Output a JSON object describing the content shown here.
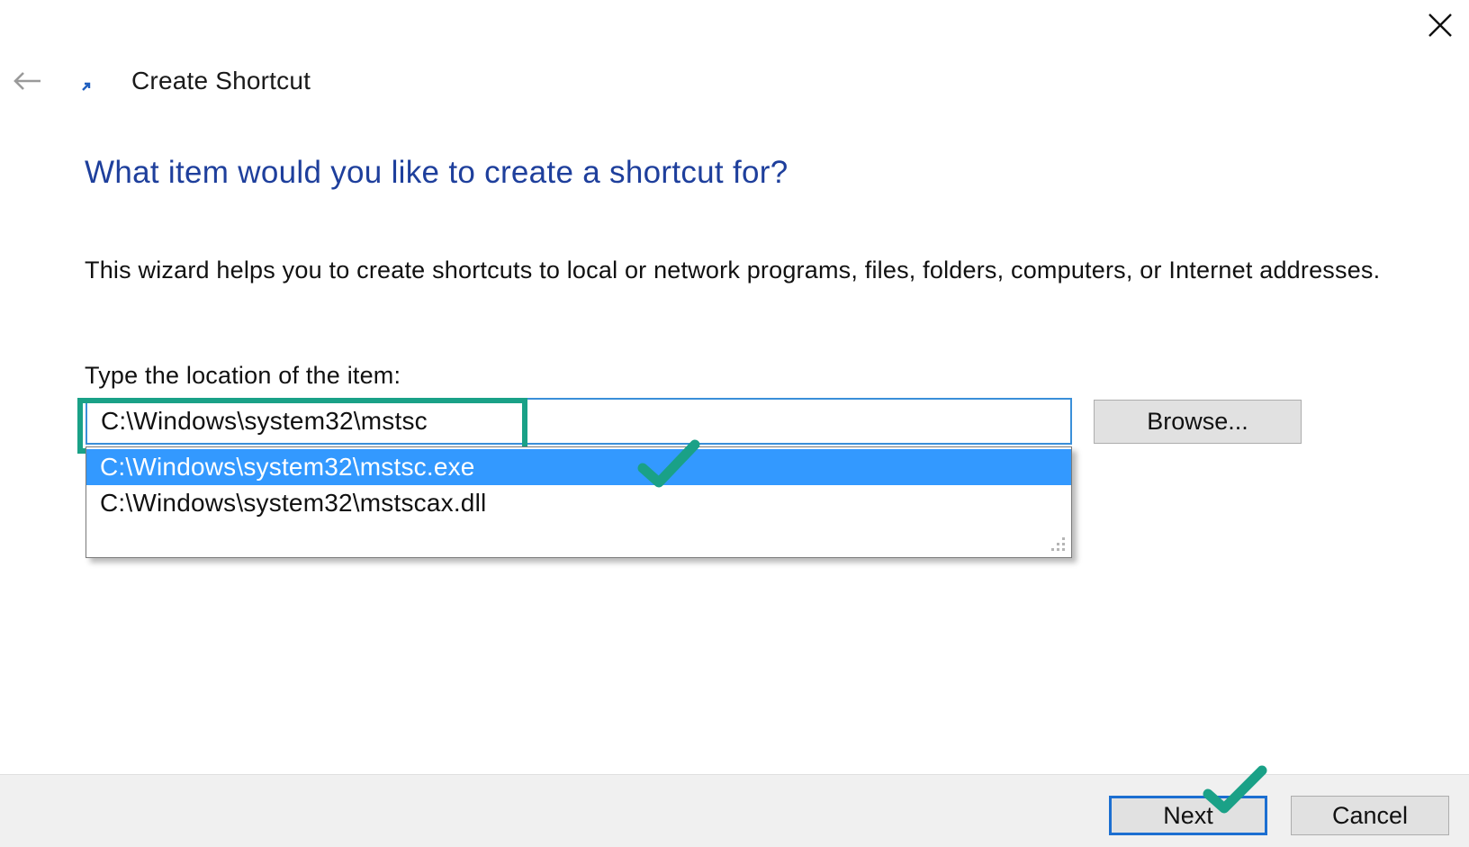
{
  "window": {
    "title": "Create Shortcut",
    "close_icon": "close-icon",
    "back_icon": "back-arrow-icon",
    "app_icon": "shortcut-arrow-icon"
  },
  "main": {
    "heading": "What item would you like to create a shortcut for?",
    "description": "This wizard helps you to create shortcuts to local or network programs, files, folders, computers, or Internet addresses.",
    "field_label": "Type the location of the item:",
    "location_value": "C:\\Windows\\system32\\mstsc",
    "browse_label": "Browse..."
  },
  "autocomplete": {
    "items": [
      {
        "label": "C:\\Windows\\system32\\mstsc.exe",
        "selected": true
      },
      {
        "label": "C:\\Windows\\system32\\mstscax.dll",
        "selected": false
      }
    ]
  },
  "footer": {
    "next_label": "Next",
    "cancel_label": "Cancel"
  },
  "annotations": {
    "highlight_color": "#1aa187",
    "checkmark_icon": "checkmark-icon"
  },
  "colors": {
    "heading": "#1e3f9c",
    "selection": "#3399ff",
    "input_border": "#3a8fd9",
    "default_button_border": "#1c6fd1"
  }
}
